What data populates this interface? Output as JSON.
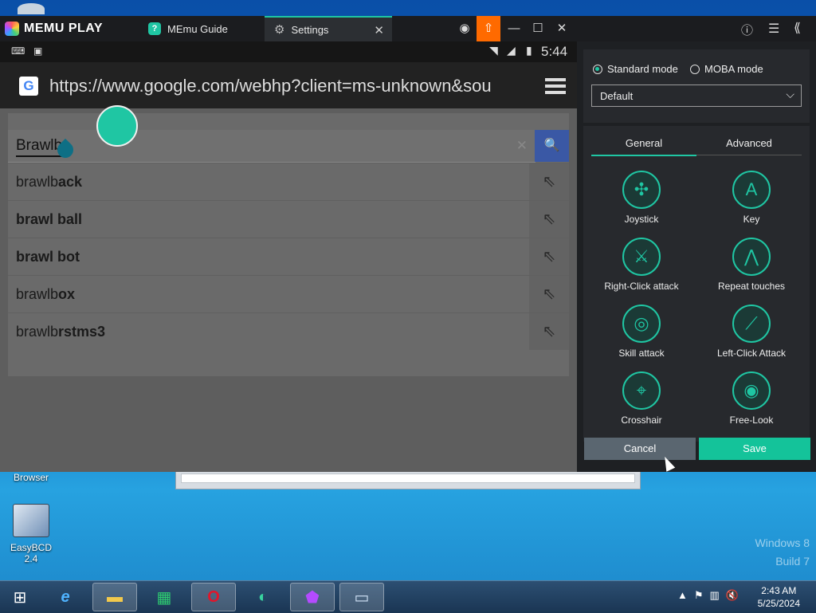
{
  "desktop": {
    "icons": [
      {
        "label": "Browser"
      },
      {
        "label": "EasyBCD 2.4"
      }
    ],
    "watermark": {
      "line1": "Windows 8",
      "line2": "Build 7"
    }
  },
  "emulator": {
    "brand": "MEMU PLAY",
    "tabs": [
      {
        "label": "MEmu Guide"
      },
      {
        "label": "Settings"
      }
    ],
    "android": {
      "time": "5:44",
      "url": "https://www.google.com/webhp?client=ms-unknown&sou",
      "search_value": "Brawlb",
      "suggestions": [
        {
          "prefix": "brawlb",
          "rest": "ack"
        },
        {
          "prefix": "",
          "rest": "brawl ball"
        },
        {
          "prefix": "",
          "rest": "brawl bot"
        },
        {
          "prefix": "brawlb",
          "rest": "ox"
        },
        {
          "prefix": "brawlb",
          "rest": "rstms3"
        }
      ]
    }
  },
  "panel": {
    "mode_standard": "Standard mode",
    "mode_moba": "MOBA mode",
    "preset": "Default",
    "tab_general": "General",
    "tab_advanced": "Advanced",
    "controls": [
      {
        "label": "Joystick",
        "icon": "joystick-icon"
      },
      {
        "label": "Key",
        "icon": "key-icon"
      },
      {
        "label": "Right-Click attack",
        "icon": "right-click-attack-icon"
      },
      {
        "label": "Repeat touches",
        "icon": "repeat-touches-icon"
      },
      {
        "label": "Skill attack",
        "icon": "skill-attack-icon"
      },
      {
        "label": "Left-Click Attack",
        "icon": "left-click-attack-icon"
      },
      {
        "label": "Crosshair",
        "icon": "crosshair-icon"
      },
      {
        "label": "Free-Look",
        "icon": "free-look-icon"
      }
    ],
    "cancel": "Cancel",
    "save": "Save"
  },
  "taskbar": {
    "time": "2:43 AM",
    "date": "5/25/2024"
  },
  "colors": {
    "accent": "#1fc6a3",
    "upload": "#ff6a00"
  }
}
